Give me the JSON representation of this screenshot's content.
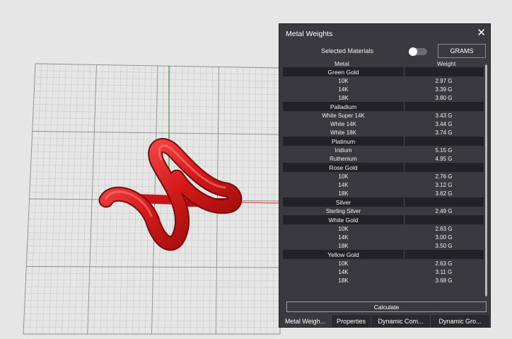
{
  "panel": {
    "title": "Metal Weights",
    "selected_materials_label": "Selected Materials",
    "unit_button": "GRAMS",
    "col_metal": "Metal",
    "col_weight": "Weight",
    "calculate_label": "Calculate"
  },
  "groups": [
    {
      "name": "Green Gold",
      "rows": [
        {
          "metal": "10K",
          "weight": "2.97 G"
        },
        {
          "metal": "14K",
          "weight": "3.39 G"
        },
        {
          "metal": "18K",
          "weight": "3.80 G"
        }
      ]
    },
    {
      "name": "Palladium",
      "rows": [
        {
          "metal": "White Super 14K",
          "weight": "3.43 G"
        },
        {
          "metal": "White 14K",
          "weight": "3.44 G"
        },
        {
          "metal": "White 18K",
          "weight": "3.74 G"
        }
      ]
    },
    {
      "name": "Platinum",
      "rows": [
        {
          "metal": "Iridium",
          "weight": "5.15 G"
        },
        {
          "metal": "Ruthenium",
          "weight": "4.95 G"
        }
      ]
    },
    {
      "name": "Rose Gold",
      "rows": [
        {
          "metal": "10K",
          "weight": "2.76 G"
        },
        {
          "metal": "14K",
          "weight": "3.12 G"
        },
        {
          "metal": "18K",
          "weight": "3.62 G"
        }
      ]
    },
    {
      "name": "Silver",
      "rows": [
        {
          "metal": "Sterling Silver",
          "weight": "2.49 G"
        }
      ]
    },
    {
      "name": "White Gold",
      "rows": [
        {
          "metal": "10K",
          "weight": "2.63 G"
        },
        {
          "metal": "14K",
          "weight": "3.00 G"
        },
        {
          "metal": "18K",
          "weight": "3.50 G"
        }
      ]
    },
    {
      "name": "Yellow Gold",
      "rows": [
        {
          "metal": "10K",
          "weight": "2.63 G"
        },
        {
          "metal": "14K",
          "weight": "3.11 G"
        },
        {
          "metal": "18K",
          "weight": "3.68 G"
        }
      ]
    }
  ],
  "tabs": [
    {
      "label": "Metal Weigh...",
      "active": true
    },
    {
      "label": "Properties",
      "active": false
    },
    {
      "label": "Dynamic Com...",
      "active": false
    },
    {
      "label": "Dynamic Gro...",
      "active": false
    }
  ],
  "colors": {
    "panel_bg": "#3a3a3e",
    "group_bg": "#222226",
    "model_red": "#d91c1c",
    "grid_bg": "#e6e6e6",
    "axis_x": "#d94a4a",
    "axis_y": "#3aa03a"
  },
  "icons": {
    "close": "close-icon"
  }
}
